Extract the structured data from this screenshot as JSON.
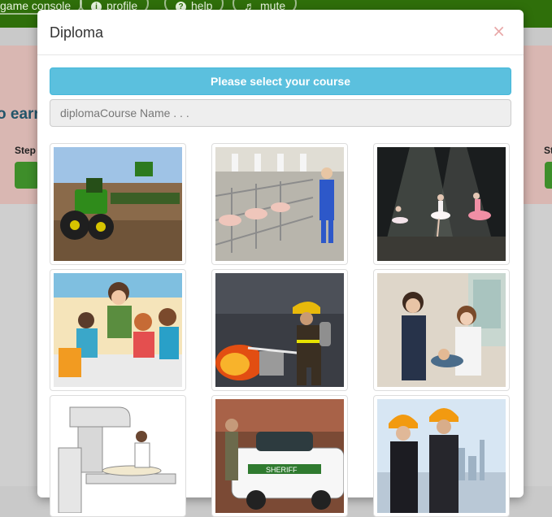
{
  "background": {
    "nav": [
      {
        "label": "game console",
        "icon": "gamepad-icon"
      },
      {
        "label": "profile",
        "icon": "info-icon"
      },
      {
        "label": "help",
        "icon": "question-icon"
      },
      {
        "label": "mute",
        "icon": "speaker-icon"
      }
    ],
    "partial_heading": "o earn",
    "step_left": "Step",
    "step_right": "St"
  },
  "modal": {
    "title": "Diploma",
    "close_symbol": "×",
    "select_label": "Please select your course",
    "search_placeholder": "diplomaCourse Name . . .",
    "search_value": ""
  },
  "courses": [
    {
      "icon": "tractor-farming-image"
    },
    {
      "icon": "pig-farm-image"
    },
    {
      "icon": "ballet-dance-image"
    },
    {
      "icon": "childcare-teacher-image"
    },
    {
      "icon": "firefighter-image"
    },
    {
      "icon": "dental-assistant-image"
    },
    {
      "icon": "radiography-machine-image"
    },
    {
      "icon": "sheriff-police-car-image"
    },
    {
      "icon": "construction-engineers-image"
    }
  ],
  "colors": {
    "nav_green": "#2f6f0a",
    "info_blue": "#5bc0de",
    "close_pink": "#e8a7a7"
  }
}
